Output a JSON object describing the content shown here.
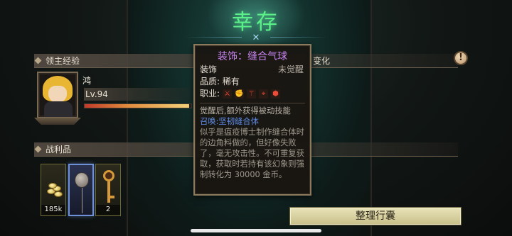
{
  "header": {
    "title": "幸存"
  },
  "sections": {
    "lord_exp": "领主经验",
    "loot": "战利品",
    "right_partial": "变化"
  },
  "hero": {
    "name": "鸿",
    "level": "Lv.94",
    "exp_progress": 0.98
  },
  "loot_items": [
    {
      "name": "coins",
      "icon": "gold-coins-icon",
      "count": "185k"
    },
    {
      "name": "stitched-balloon",
      "icon": "balloon-icon",
      "count": ""
    },
    {
      "name": "key",
      "icon": "ornate-key-icon",
      "count": "2"
    }
  ],
  "tooltip": {
    "title": "装饰：缝合气球",
    "type": "装饰",
    "awaken_status": "未觉醒",
    "quality": "品质: 稀有",
    "job_label": "职业:",
    "job_icons": [
      "sword-icon",
      "fist-icon",
      "staff-icon",
      "crosshair-icon",
      "shield-icon"
    ],
    "awaken_text": "觉醒后,额外获得被动技能",
    "summon": "召唤:坚韧缝合体",
    "description": "似乎是瘟疫博士制作缝合体时的边角料做的，但好像失败了，毫无攻击性。不可重复获取，获取时若持有该幻象则强制转化为 30000 金币。"
  },
  "buttons": {
    "organize": "整理行囊"
  },
  "colors": {
    "title": "#5cf08a",
    "tooltip_title": "#c784f0",
    "summon": "#5e8ce8"
  }
}
